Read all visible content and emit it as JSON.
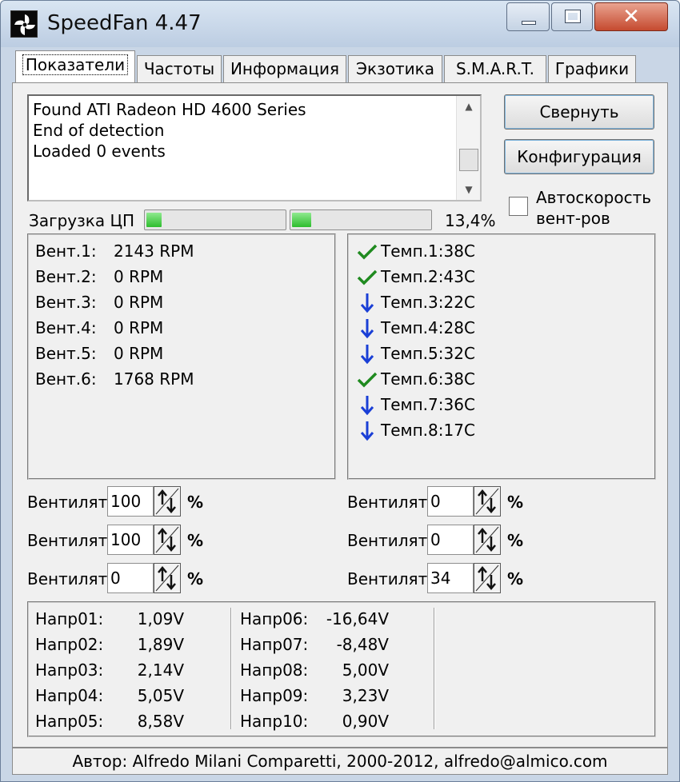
{
  "window": {
    "title": "SpeedFan 4.47"
  },
  "tabs": [
    {
      "label": "Показатели"
    },
    {
      "label": "Частоты"
    },
    {
      "label": "Информация"
    },
    {
      "label": "Экзотика"
    },
    {
      "label": "S.M.A.R.T."
    },
    {
      "label": "Графики"
    }
  ],
  "log": {
    "lines": [
      "Found ATI Radeon HD 4600 Series",
      "End of detection",
      "Loaded 0 events"
    ]
  },
  "buttons": {
    "collapse": "Свернуть",
    "config": "Конфигурация"
  },
  "auto_speed": {
    "label": "Автоскорость вент-ров",
    "checked": false
  },
  "cpu": {
    "label": "Загрузка ЦП",
    "value": "13,4%",
    "bars": [
      0.11,
      0.14
    ]
  },
  "fans": [
    {
      "label": "Вент.1:",
      "value": "2143 RPM"
    },
    {
      "label": "Вент.2:",
      "value": "0 RPM"
    },
    {
      "label": "Вент.3:",
      "value": "0 RPM"
    },
    {
      "label": "Вент.4:",
      "value": "0 RPM"
    },
    {
      "label": "Вент.5:",
      "value": "0 RPM"
    },
    {
      "label": "Вент.6:",
      "value": "1768 RPM"
    }
  ],
  "temps": [
    {
      "text": "Темп.1:38C",
      "status": "check-icon"
    },
    {
      "text": "Темп.2:43C",
      "status": "check-icon"
    },
    {
      "text": "Темп.3:22C",
      "status": "arrow-down-icon"
    },
    {
      "text": "Темп.4:28C",
      "status": "arrow-down-icon"
    },
    {
      "text": "Темп.5:32C",
      "status": "arrow-down-icon"
    },
    {
      "text": "Темп.6:38C",
      "status": "check-icon"
    },
    {
      "text": "Темп.7:36C",
      "status": "arrow-down-icon"
    },
    {
      "text": "Темп.8:17C",
      "status": "arrow-down-icon"
    }
  ],
  "fan_speeds": {
    "label": "Вентилятор",
    "unit": "%",
    "left": [
      "100",
      "100",
      "0"
    ],
    "right": [
      "0",
      "0",
      "34"
    ]
  },
  "voltages": [
    {
      "label": "Напр01:",
      "value": "1,09V"
    },
    {
      "label": "Напр02:",
      "value": "1,89V"
    },
    {
      "label": "Напр03:",
      "value": "2,14V"
    },
    {
      "label": "Напр04:",
      "value": "5,05V"
    },
    {
      "label": "Напр05:",
      "value": "8,58V"
    },
    {
      "label": "Напр06:",
      "value": "-16,64V"
    },
    {
      "label": "Напр07:",
      "value": "-8,48V"
    },
    {
      "label": "Напр08:",
      "value": "5,00V"
    },
    {
      "label": "Напр09:",
      "value": "3,23V"
    },
    {
      "label": "Напр10:",
      "value": "0,90V"
    }
  ],
  "status": {
    "text": "Автор: Alfredo Milani Comparetti, 2000-2012, alfredo@almico.com"
  },
  "colors": {
    "check": "#1f8a1f",
    "arrow_down": "#1a3fd6",
    "progress": "#2ebd2e",
    "close_button": "#c54a2f"
  }
}
